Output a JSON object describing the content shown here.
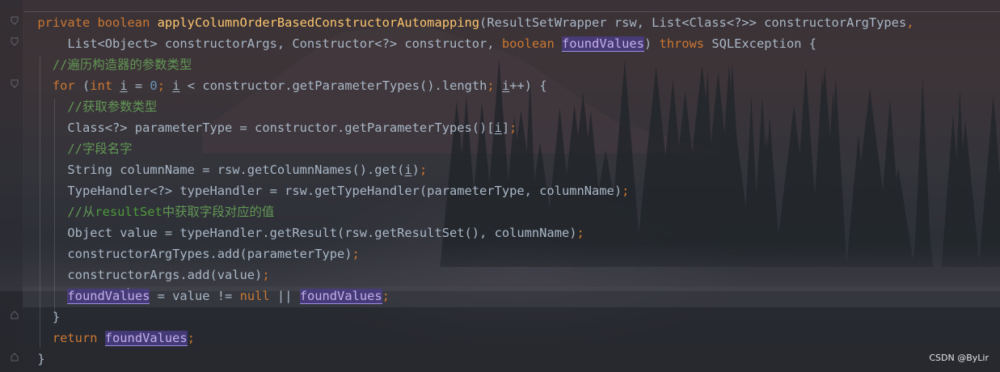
{
  "editor": {
    "lines": [
      {
        "indent": "  ",
        "tokens": [
          {
            "t": "private boolean ",
            "c": "kw"
          },
          {
            "t": "applyColumnOrderBasedConstructorAutomapping",
            "c": "fn"
          },
          {
            "t": "(ResultSetWrapper rsw, List<Class<?>> constructorArgTypes",
            "c": "p"
          },
          {
            "t": ",",
            "c": "kw"
          }
        ]
      },
      {
        "indent": "      ",
        "tokens": [
          {
            "t": "List<Object> constructorArgs, Constructor<?> constructor, ",
            "c": "p"
          },
          {
            "t": "boolean ",
            "c": "kw"
          },
          {
            "t": "foundValues",
            "c": "fld"
          },
          {
            "t": ") ",
            "c": "p"
          },
          {
            "t": "throws ",
            "c": "kw"
          },
          {
            "t": "SQLException {",
            "c": "p"
          }
        ]
      },
      {
        "indent": "    ",
        "tokens": [
          {
            "t": "//遍历构造器的参数类型",
            "c": "cm"
          }
        ]
      },
      {
        "indent": "    ",
        "tokens": [
          {
            "t": "for ",
            "c": "kw"
          },
          {
            "t": "(",
            "c": "p"
          },
          {
            "t": "int ",
            "c": "kw"
          },
          {
            "t": "i",
            "c": "ivar"
          },
          {
            "t": " = ",
            "c": "p"
          },
          {
            "t": "0",
            "c": "num"
          },
          {
            "t": "; ",
            "c": "kw"
          },
          {
            "t": "i",
            "c": "ivar"
          },
          {
            "t": " < constructor.getParameterTypes().length",
            "c": "p"
          },
          {
            "t": "; ",
            "c": "kw"
          },
          {
            "t": "i",
            "c": "ivar"
          },
          {
            "t": "++) {",
            "c": "p"
          }
        ]
      },
      {
        "indent": "      ",
        "tokens": [
          {
            "t": "//获取参数类型",
            "c": "cm"
          }
        ]
      },
      {
        "indent": "      ",
        "tokens": [
          {
            "t": "Class<?> parameterType = constructor.getParameterTypes()[",
            "c": "p"
          },
          {
            "t": "i",
            "c": "ivar"
          },
          {
            "t": "]",
            "c": "p"
          },
          {
            "t": ";",
            "c": "kw"
          }
        ]
      },
      {
        "indent": "      ",
        "tokens": [
          {
            "t": "//字段名字",
            "c": "cm"
          }
        ]
      },
      {
        "indent": "      ",
        "tokens": [
          {
            "t": "String columnName = rsw.getColumnNames().get(",
            "c": "p"
          },
          {
            "t": "i",
            "c": "ivar"
          },
          {
            "t": ")",
            "c": "p"
          },
          {
            "t": ";",
            "c": "kw"
          }
        ]
      },
      {
        "indent": "      ",
        "tokens": [
          {
            "t": "TypeHandler<?> typeHandler = rsw.getTypeHandler(parameterType, columnName)",
            "c": "p"
          },
          {
            "t": ";",
            "c": "kw"
          }
        ]
      },
      {
        "indent": "      ",
        "tokens": [
          {
            "t": "//从",
            "c": "cm"
          },
          {
            "t": "resultSet",
            "c": "cm-b"
          },
          {
            "t": "中获取字段对应的值",
            "c": "cm"
          }
        ]
      },
      {
        "indent": "      ",
        "tokens": [
          {
            "t": "Object value = typeHandler.getResult(rsw.getResultSet(), columnName)",
            "c": "p"
          },
          {
            "t": ";",
            "c": "kw"
          }
        ]
      },
      {
        "indent": "      ",
        "tokens": [
          {
            "t": "constructorArgTypes.add(parameterType)",
            "c": "p"
          },
          {
            "t": ";",
            "c": "kw"
          }
        ]
      },
      {
        "indent": "      ",
        "tokens": [
          {
            "t": "constructorArgs.add(value)",
            "c": "p"
          },
          {
            "t": ";",
            "c": "kw"
          }
        ]
      },
      {
        "indent": "      ",
        "caret": true,
        "tokens": [
          {
            "t": "foundVal",
            "c": "fld"
          },
          {
            "t": "CARET",
            "c": "caret"
          },
          {
            "t": "ues",
            "c": "fld"
          },
          {
            "t": " = value != ",
            "c": "p"
          },
          {
            "t": "null ",
            "c": "kw"
          },
          {
            "t": "|| ",
            "c": "p"
          },
          {
            "t": "foundValues",
            "c": "fld"
          },
          {
            "t": ";",
            "c": "kw"
          }
        ]
      },
      {
        "indent": "    ",
        "tokens": [
          {
            "t": "}",
            "c": "p"
          }
        ]
      },
      {
        "indent": "    ",
        "tokens": [
          {
            "t": "return ",
            "c": "kw"
          },
          {
            "t": "foundValues",
            "c": "fld"
          },
          {
            "t": ";",
            "c": "kw"
          }
        ]
      },
      {
        "indent": "  ",
        "tokens": [
          {
            "t": "}",
            "c": "p"
          }
        ]
      }
    ]
  },
  "watermark": "CSDN @ByLir",
  "colors": {
    "keyword": "#cc7832",
    "method": "#ffc66d",
    "number": "#6897bb",
    "comment": "#629755",
    "plain": "#a9b7c6",
    "field_highlight": "#493c82"
  },
  "icons": [
    "fold-marker-icon"
  ]
}
